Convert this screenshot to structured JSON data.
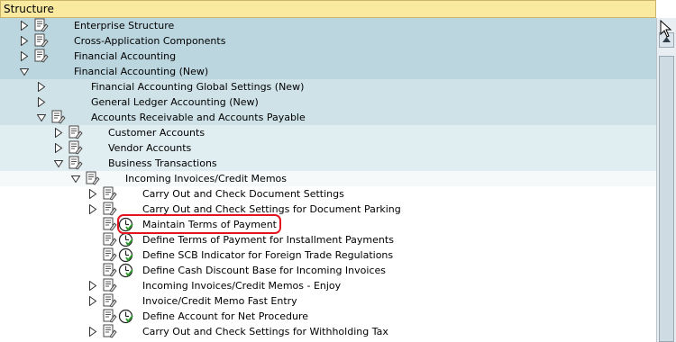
{
  "header": {
    "title": "Structure"
  },
  "tree": [
    {
      "label": "Enterprise Structure",
      "level": 1,
      "toggle": "collapsed",
      "icon": "doc"
    },
    {
      "label": "Cross-Application Components",
      "level": 1,
      "toggle": "collapsed",
      "icon": "doc"
    },
    {
      "label": "Financial Accounting",
      "level": 1,
      "toggle": "collapsed",
      "icon": "doc"
    },
    {
      "label": "Financial Accounting (New)",
      "level": 1,
      "toggle": "expanded",
      "icon": "none"
    },
    {
      "label": "Financial Accounting Global Settings (New)",
      "level": 2,
      "toggle": "collapsed",
      "icon": "none"
    },
    {
      "label": "General Ledger Accounting (New)",
      "level": 2,
      "toggle": "collapsed",
      "icon": "none"
    },
    {
      "label": "Accounts Receivable and Accounts Payable",
      "level": 2,
      "toggle": "expanded",
      "icon": "doc"
    },
    {
      "label": "Customer Accounts",
      "level": 3,
      "toggle": "collapsed",
      "icon": "doc"
    },
    {
      "label": "Vendor Accounts",
      "level": 3,
      "toggle": "collapsed",
      "icon": "doc"
    },
    {
      "label": "Business Transactions",
      "level": 3,
      "toggle": "expanded",
      "icon": "doc"
    },
    {
      "label": "Incoming Invoices/Credit Memos",
      "level": 4,
      "toggle": "expanded",
      "icon": "doc"
    },
    {
      "label": "Carry Out and Check Document Settings",
      "level": 5,
      "toggle": "collapsed",
      "icon": "doc"
    },
    {
      "label": "Carry Out and Check Settings for Document Parking",
      "level": 5,
      "toggle": "collapsed",
      "icon": "doc"
    },
    {
      "label": "Maintain Terms of Payment",
      "level": 5,
      "toggle": "none",
      "icon": "doc-clock",
      "highlighted": true
    },
    {
      "label": "Define Terms of Payment for Installment Payments",
      "level": 5,
      "toggle": "none",
      "icon": "doc-clock"
    },
    {
      "label": "Define SCB Indicator for Foreign Trade Regulations",
      "level": 5,
      "toggle": "none",
      "icon": "doc-clock"
    },
    {
      "label": "Define Cash Discount Base for Incoming Invoices",
      "level": 5,
      "toggle": "none",
      "icon": "doc-clock"
    },
    {
      "label": "Incoming Invoices/Credit Memos - Enjoy",
      "level": 5,
      "toggle": "collapsed",
      "icon": "doc"
    },
    {
      "label": "Invoice/Credit Memo Fast Entry",
      "level": 5,
      "toggle": "collapsed",
      "icon": "doc"
    },
    {
      "label": "Define Account for Net Procedure",
      "level": 5,
      "toggle": "none",
      "icon": "doc-clock"
    },
    {
      "label": "Carry Out and Check Settings for Withholding Tax",
      "level": 5,
      "toggle": "collapsed",
      "icon": "doc"
    }
  ],
  "colors": {
    "header_bg": "#f9eaa0",
    "highlight": "#e3141e",
    "level1_bg": "#bcd6df"
  }
}
